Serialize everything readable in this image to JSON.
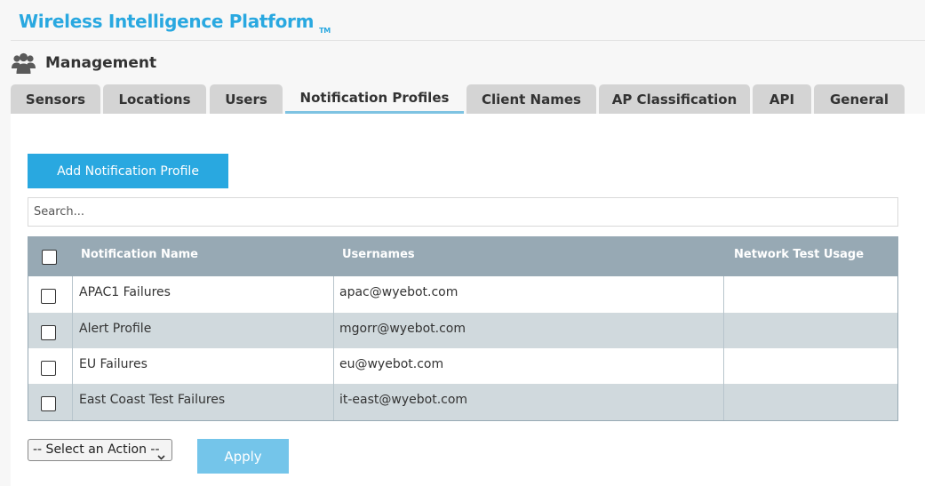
{
  "app": {
    "title": "Wireless Intelligence Platform",
    "trademark": "TM"
  },
  "section": {
    "title": "Management",
    "icon": "users-icon"
  },
  "tabs": [
    {
      "label": "Sensors",
      "active": false
    },
    {
      "label": "Locations",
      "active": false
    },
    {
      "label": "Users",
      "active": false
    },
    {
      "label": "Notification Profiles",
      "active": true
    },
    {
      "label": "Client Names",
      "active": false
    },
    {
      "label": "AP Classification",
      "active": false
    },
    {
      "label": "API",
      "active": false
    },
    {
      "label": "General",
      "active": false
    }
  ],
  "toolbar": {
    "add_label": "Add Notification Profile"
  },
  "search": {
    "placeholder": "Search...",
    "value": ""
  },
  "table": {
    "columns": [
      "Notification Name",
      "Usernames",
      "Network Test Usage"
    ],
    "rows": [
      {
        "name": "APAC1 Failures",
        "usernames": "apac@wyebot.com",
        "network_test_usage": ""
      },
      {
        "name": "Alert Profile",
        "usernames": "mgorr@wyebot.com",
        "network_test_usage": ""
      },
      {
        "name": "EU Failures",
        "usernames": "eu@wyebot.com",
        "network_test_usage": ""
      },
      {
        "name": "East Coast Test Failures",
        "usernames": "it-east@wyebot.com",
        "network_test_usage": ""
      }
    ]
  },
  "footer": {
    "action_select": "-- Select an Action --",
    "apply_label": "Apply"
  },
  "colors": {
    "accent": "#29a8e0",
    "header_row": "#97a9b4",
    "alt_row": "#d0d9dd",
    "apply_disabled": "#74c5ea"
  }
}
